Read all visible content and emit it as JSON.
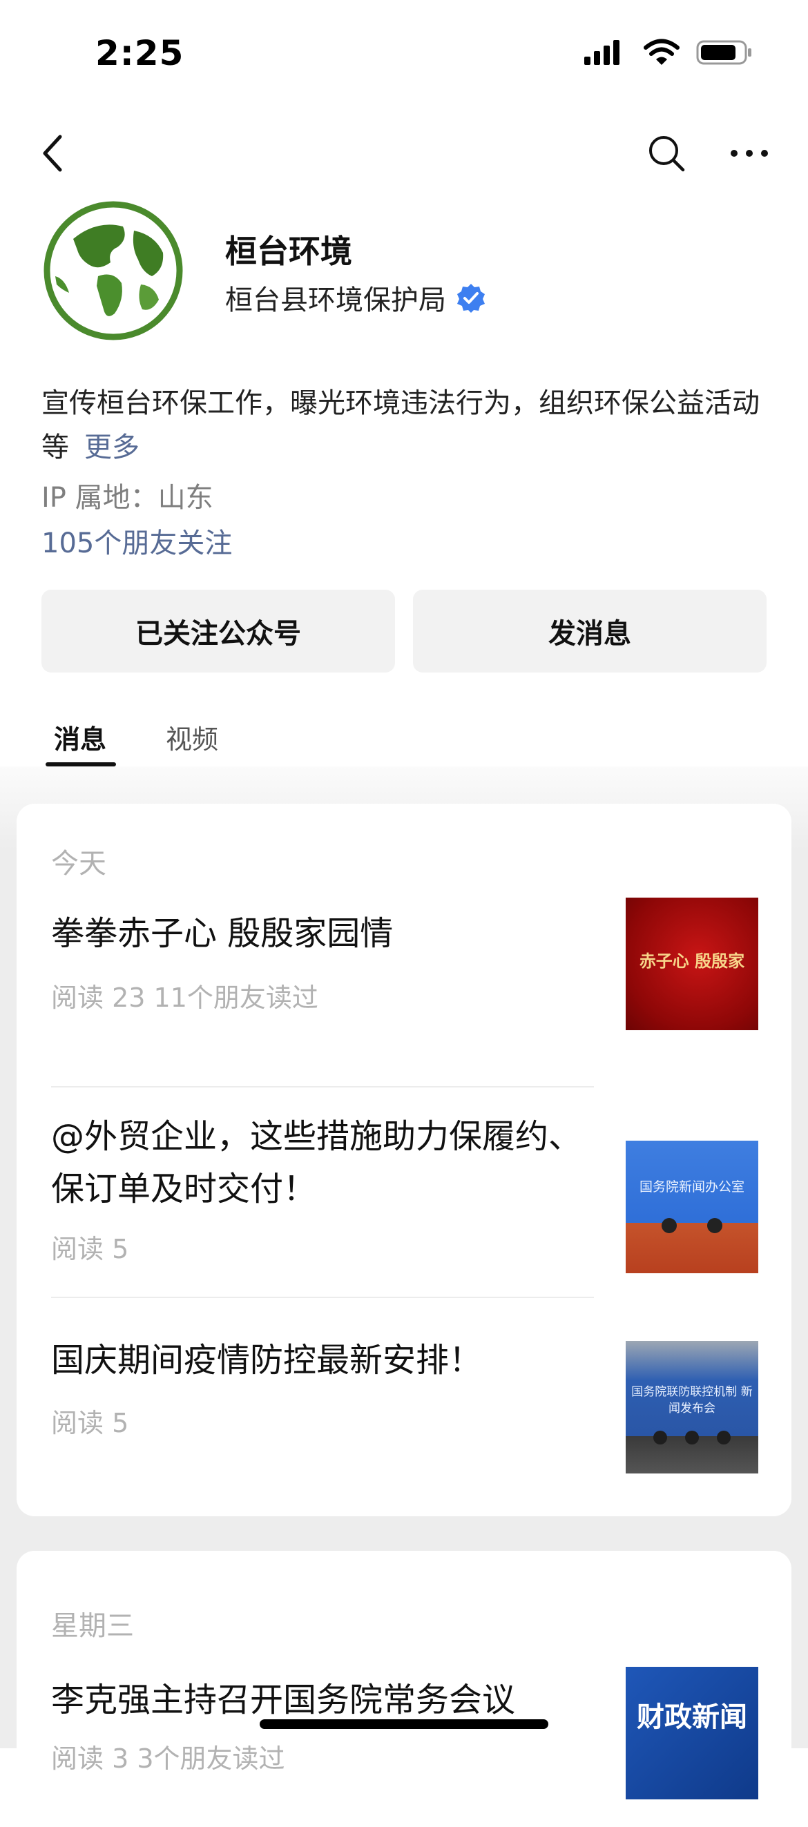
{
  "status_bar": {
    "time": "2:25",
    "icons": [
      "signal-icon",
      "wifi-icon",
      "battery-icon"
    ]
  },
  "nav": {
    "icons": [
      "chevron-left-icon",
      "search-icon",
      "more-icon"
    ]
  },
  "profile": {
    "name": "桓台环境",
    "org": "桓台县环境保护局",
    "verified_icon": "verified-badge-icon",
    "description": "宣传桓台环保工作，曝光环境违法行为，组织环保公益活动等",
    "more_label": "更多",
    "ip_location": "IP 属地：山东",
    "friends_follow": "105个朋友关注"
  },
  "actions": {
    "follow_label": "已关注公众号",
    "message_label": "发消息"
  },
  "tabs": [
    {
      "label": "消息",
      "active": true
    },
    {
      "label": "视频",
      "active": false
    }
  ],
  "feed": {
    "today": {
      "date": "今天",
      "articles": [
        {
          "title": "拳拳赤子心  殷殷家园情",
          "meta": "阅读 23   11个朋友读过",
          "thumb_text": "赤子心  殷殷家"
        },
        {
          "title": "@外贸企业，这些措施助力保履约、保订单及时交付！",
          "meta": "阅读 5",
          "thumb_text": "国务院新闻办公室"
        },
        {
          "title": "国庆期间疫情防控最新安排！",
          "meta": "阅读 5",
          "thumb_text": "国务院联防联控机制 新闻发布会"
        }
      ]
    },
    "wednesday": {
      "date": "星期三",
      "articles": [
        {
          "title": "李克强主持召开国务院常务会议",
          "meta": "阅读 3   3个朋友读过",
          "thumb_text": "财政新闻"
        }
      ]
    }
  },
  "colors": {
    "link": "#576b95",
    "verified": "#3d7ff0",
    "gray_text": "#b2b2b2",
    "feed_bg": "#ededed"
  }
}
